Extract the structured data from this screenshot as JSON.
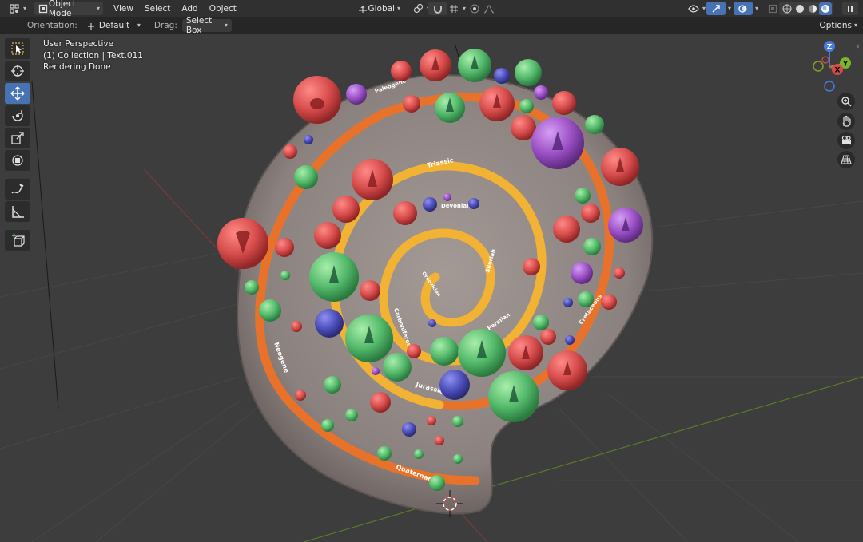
{
  "header": {
    "editor_icon": "grid-cursor-icon",
    "mode": "Object Mode",
    "menus": [
      "View",
      "Select",
      "Add",
      "Object"
    ],
    "transform_orientation": "Global",
    "icons": [
      "link-icon",
      "magnet-icon",
      "snap-grid-icon",
      "proportional-edit-icon",
      "falloff-icon",
      "visibility-icon",
      "gizmo-icon",
      "overlay-icon",
      "xray-icon",
      "shading-wire-icon",
      "shading-solid-icon",
      "shading-material-icon",
      "shading-render-icon",
      "pause-icon"
    ]
  },
  "tool_settings": {
    "orientation_label": "Orientation:",
    "orientation_value": "Default",
    "drag_label": "Drag:",
    "drag_value": "Select Box",
    "options_label": "Options"
  },
  "viewport": {
    "perspective": "User Perspective",
    "collection": "(1) Collection | Text.011",
    "status": "Rendering Done",
    "spiral_labels": [
      "Paleogene",
      "Triassic",
      "Devonian",
      "Silurian",
      "Ordovician",
      "Carboniferous",
      "Permian",
      "Jurassic",
      "Cretaceous",
      "Neogene",
      "Quaternary"
    ],
    "gizmo_axes": [
      "Z",
      "Y",
      "X"
    ],
    "colors": {
      "background": "#3d3d3d",
      "rock": "#8f8683",
      "outer_spiral": "#e9722b",
      "inner_spiral": "#f2b233",
      "bubble_red": "#d64b4b",
      "bubble_green": "#52b86a",
      "bubble_blue": "#4a4cb8",
      "bubble_purple": "#9a4fc4"
    }
  },
  "tools": [
    {
      "name": "select-box-tool",
      "active": false
    },
    {
      "name": "cursor-tool",
      "active": false
    },
    {
      "name": "move-tool",
      "active": true
    },
    {
      "name": "rotate-tool",
      "active": false
    },
    {
      "name": "scale-tool",
      "active": false
    },
    {
      "name": "transform-tool",
      "active": false
    },
    {
      "name": "annotate-tool",
      "active": false
    },
    {
      "name": "measure-tool",
      "active": false
    },
    {
      "name": "add-cube-tool",
      "active": false
    }
  ]
}
